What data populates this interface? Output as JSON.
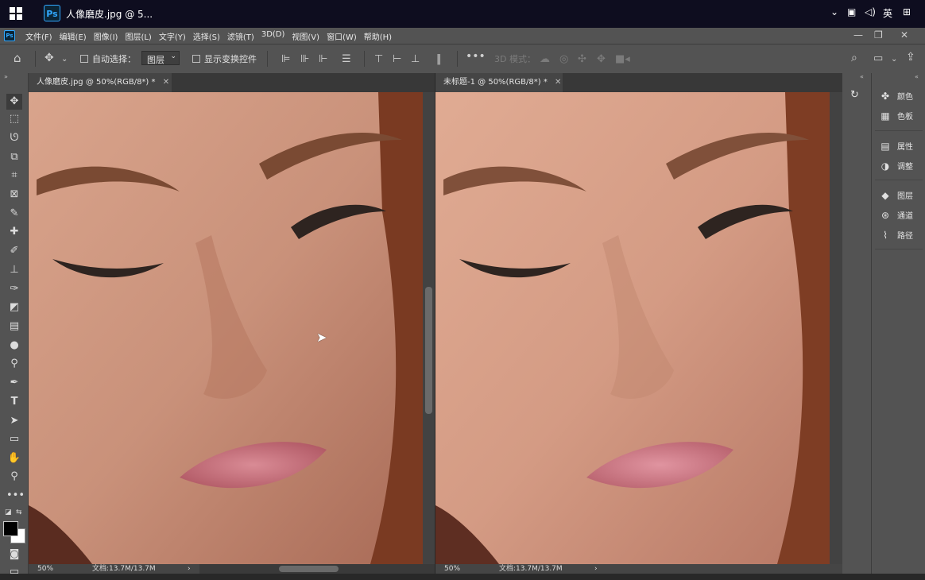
{
  "taskbar": {
    "app_badge": "Ps",
    "window_title": "人像磨皮.jpg @ 5...",
    "ime_label": "英"
  },
  "menubar": {
    "logo": "Ps",
    "items": [
      "文件(F)",
      "编辑(E)",
      "图像(I)",
      "图层(L)",
      "文字(Y)",
      "选择(S)",
      "滤镜(T)",
      "3D(D)",
      "视图(V)",
      "窗口(W)",
      "帮助(H)"
    ]
  },
  "options": {
    "auto_select_label": "自动选择：",
    "auto_select_value": "图层",
    "show_transform_label": "显示变换控件",
    "threed_mode_label": "3D 模式："
  },
  "documents": [
    {
      "tab_title": "人像磨皮.jpg @ 50%(RGB/8*) *",
      "zoom": "50%",
      "doc_info": "文档:13.7M/13.7M"
    },
    {
      "tab_title": "未标题-1 @ 50%(RGB/8*) *",
      "zoom": "50%",
      "doc_info": "文档:13.7M/13.7M"
    }
  ],
  "panels": [
    "颜色",
    "色板",
    "属性",
    "调整",
    "图层",
    "通道",
    "路径"
  ],
  "colors": {
    "accent": "#31a8ff",
    "chrome": "#535353",
    "workspace": "#282828",
    "foreground": "#000000",
    "background": "#ffffff"
  }
}
